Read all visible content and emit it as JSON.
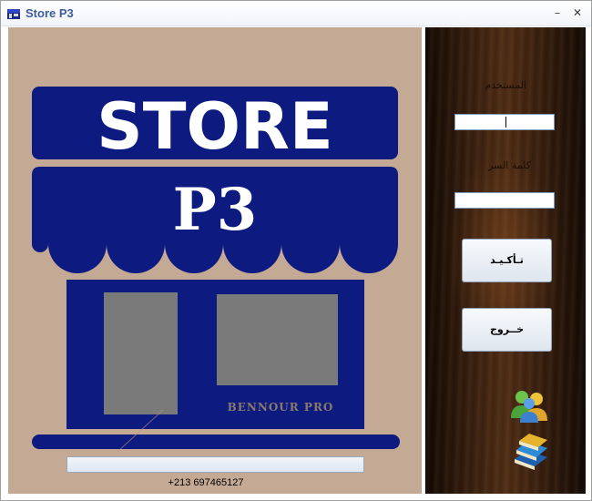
{
  "window": {
    "title": "Store P3",
    "minimize_glyph": "–",
    "close_glyph": "✕"
  },
  "logo": {
    "line1": "STORE",
    "line2": "P3",
    "signature": "BENNOUR PRO",
    "colors": {
      "navy": "#0d1a80",
      "window_gray": "#7a7a7a",
      "background": "#c4a995"
    }
  },
  "footer": {
    "phone": "+213 697465127"
  },
  "login": {
    "username_label": "المستخدم",
    "password_label": "كلمة السر",
    "username_value": "",
    "password_value": "",
    "confirm_button": "تـأكـيـد",
    "exit_button": "خــروج"
  },
  "icons": {
    "users": "users-icon",
    "books": "books-icon",
    "app": "store-app-icon"
  }
}
